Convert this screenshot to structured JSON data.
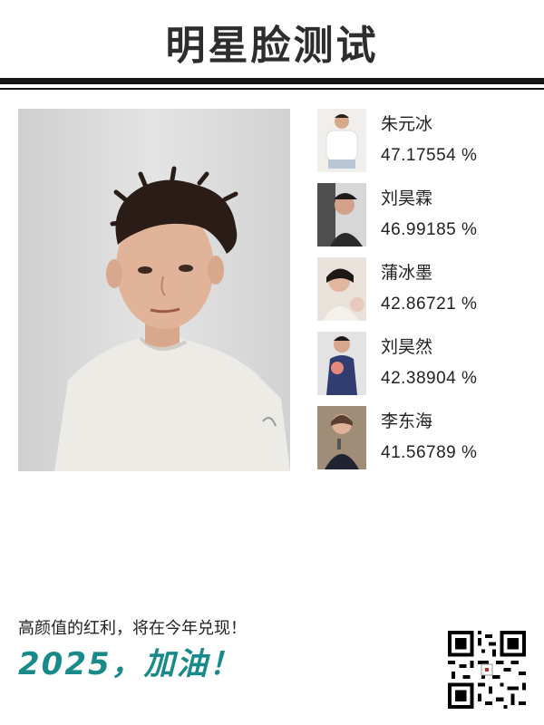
{
  "header": {
    "title": "明星脸测试"
  },
  "main_photo": {
    "icon": "portrait-photo"
  },
  "matches": [
    {
      "name": "朱元冰",
      "score": "47.17554 %",
      "thumb_color": "#e8e6e0"
    },
    {
      "name": "刘昊霖",
      "score": "46.99185 %",
      "thumb_color": "#6b6f74"
    },
    {
      "name": "蒲冰墨",
      "score": "42.86721 %",
      "thumb_color": "#cfc6bd"
    },
    {
      "name": "刘昊然",
      "score": "42.38904 %",
      "thumb_color": "#3a4a7a"
    },
    {
      "name": "李东海",
      "score": "41.56789 %",
      "thumb_color": "#8d7d6b"
    }
  ],
  "footer": {
    "slogan": "高颜值的红利，将在今年兑现！",
    "cheer": "2025，加油！",
    "cheer_color": "#198a8a",
    "qr_icon": "qr-code-icon"
  }
}
